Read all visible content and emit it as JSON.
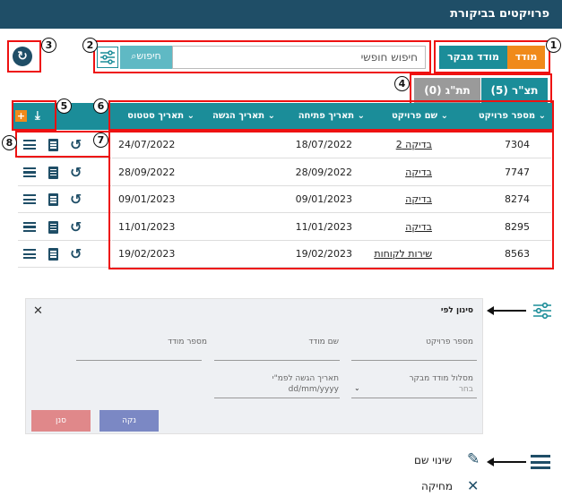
{
  "header": {
    "title": "פרויקטים בביקורת"
  },
  "badges": [
    "1",
    "2",
    "3",
    "4",
    "5",
    "6",
    "7",
    "8"
  ],
  "mode_buttons": {
    "left": "מודד",
    "right": "מודד מבקר"
  },
  "search": {
    "button": "חיפוש",
    "placeholder": "חיפוש חופשי"
  },
  "tabs": {
    "active": "תצ\"ר (5)",
    "inactive": "תת\"ג (0)"
  },
  "columns": [
    "מספר פרויקט",
    "שם פרויקט",
    "תאריך פתיחה",
    "תאריך הגשה",
    "תאריך סטטוס"
  ],
  "rows": [
    {
      "id": "7304",
      "name": "בדיקה 2",
      "opened": "18/07/2022",
      "status_date": "24/07/2022"
    },
    {
      "id": "7747",
      "name": "בדיקה",
      "opened": "28/09/2022",
      "status_date": "28/09/2022"
    },
    {
      "id": "8274",
      "name": "בדיקה",
      "opened": "09/01/2023",
      "status_date": "09/01/2023"
    },
    {
      "id": "8295",
      "name": "בדיקה",
      "opened": "11/01/2023",
      "status_date": "11/01/2023"
    },
    {
      "id": "8563",
      "name": "שירות לקוחות",
      "opened": "19/02/2023",
      "status_date": "19/02/2023"
    }
  ],
  "filter_panel": {
    "title": "סינון לפי",
    "close": "✕",
    "fields": [
      "מספר פרויקט",
      "שם מודד",
      "מספר מודד"
    ],
    "row2": {
      "label1": "מסלול מודד מבקר",
      "select_value": "בחר",
      "label2": "תאריך הגשה לפמ\"י",
      "date_placeholder": "dd/mm/yyyy"
    },
    "clear": "נקה",
    "filter": "סנן"
  },
  "menu": {
    "rename": "שינוי שם",
    "delete": "מחיקה"
  },
  "colors": {
    "header": "#1f4e67",
    "teal": "#1b8d99",
    "orange": "#f08a1a",
    "highlight": "#e11"
  }
}
